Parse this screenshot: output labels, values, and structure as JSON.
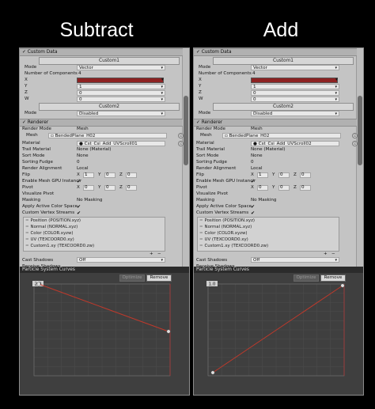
{
  "headings": {
    "left": "Subtract",
    "right": "Add"
  },
  "custom_data": {
    "header": "Custom Data",
    "custom1": "Custom1",
    "mode_label": "Mode",
    "mode_value": "Vector",
    "num_components_label": "Number of Components",
    "num_components_value": "4",
    "x_label": "X",
    "y_label": "Y",
    "z_label": "Z",
    "w_label": "W",
    "y_value": "1",
    "z_value": "0",
    "w_value": "0",
    "custom2": "Custom2",
    "mode2_value": "Disabled"
  },
  "renderer": {
    "header": "Renderer",
    "render_mode_label": "Render Mode",
    "render_mode_value": "Mesh",
    "mesh_label": "Mesh",
    "mesh_value": "BendedPlane_H02",
    "material_label": "Material",
    "material_left": "Cst_Csi_Add_UVScroll01",
    "material_right": "Cst_Csi_Add_UVScroll02",
    "trail_material_label": "Trail Material",
    "trail_material_value": "None (Material)",
    "sort_mode_label": "Sort Mode",
    "sort_mode_value": "None",
    "sorting_fudge_label": "Sorting Fudge",
    "sorting_fudge_value": "0",
    "render_alignment_label": "Render Alignment",
    "render_alignment_value": "Local",
    "flip_label": "Flip",
    "enable_gpu_label": "Enable Mesh GPU Instancir",
    "pivot_label": "Pivot",
    "visualize_pivot_label": "Visualize Pivot",
    "masking_label": "Masking",
    "masking_value": "No Masking",
    "apply_color_space_label": "Apply Active Color Space",
    "custom_vertex_label": "Custom Vertex Streams",
    "axis": {
      "x": "X",
      "y": "Y",
      "z": "Z"
    },
    "flip_values": [
      "1",
      "0",
      "0"
    ],
    "pivot_values": [
      "0",
      "0",
      "0"
    ],
    "streams": [
      "Position (POSITION.xyz)",
      "Normal (NORMAL.xyz)",
      "Color (COLOR.xyzw)",
      "UV (TEXCOORD0.xy)",
      "Custom1.xy (TEXCOORD0.zw)"
    ],
    "cast_shadows_label": "Cast Shadows",
    "cast_shadows_value": "Off",
    "receive_shadows_label": "Receive Shadows"
  },
  "curves": {
    "title": "Particle System Curves",
    "optimize": "Optimize",
    "remove": "Remove",
    "left_top_label": "2.0",
    "right_top_label": "1.0",
    "left_curve": {
      "start": 1.0,
      "end": 0.0
    },
    "right_curve": {
      "start": 0.0,
      "end": 1.0
    }
  },
  "colors": {
    "accent_red": "#c0392b",
    "curve_bg": "#3f3f3f",
    "inspector_bg": "#c4c4c4"
  }
}
